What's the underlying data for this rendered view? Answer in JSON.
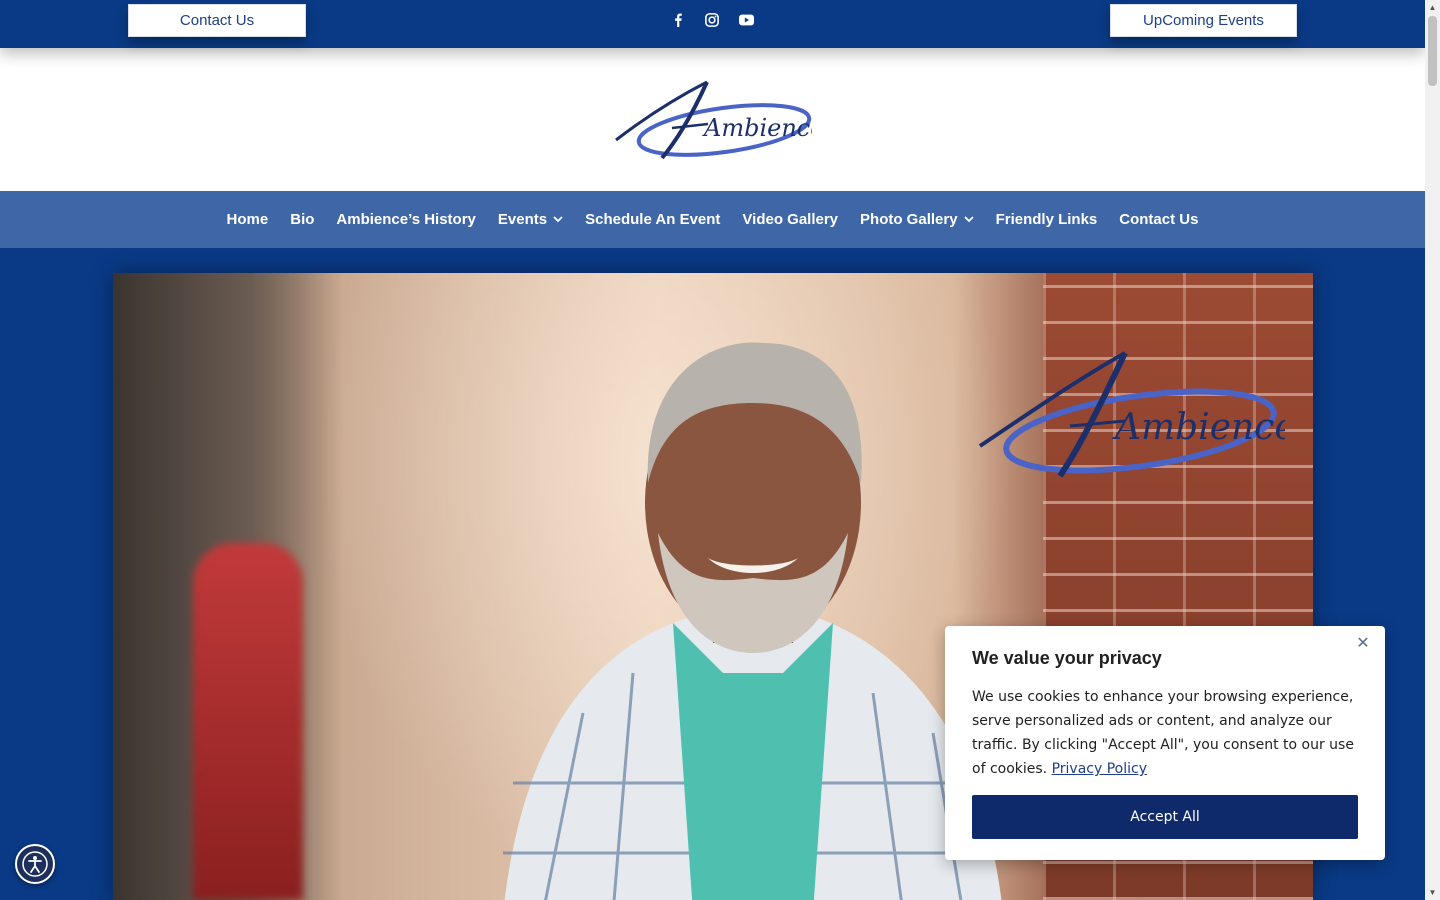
{
  "topbar": {
    "contact_label": "Contact Us",
    "events_label": "UpComing Events",
    "social_icons": [
      "facebook-icon",
      "instagram-icon",
      "youtube-icon"
    ]
  },
  "logo": {
    "text": "Ambience",
    "colors": {
      "primary": "#1d2f6b",
      "swoosh": "#4a63c7"
    }
  },
  "nav": {
    "items": [
      {
        "label": "Home",
        "has_dropdown": false
      },
      {
        "label": "Bio",
        "has_dropdown": false
      },
      {
        "label": "Ambience’s History",
        "has_dropdown": false
      },
      {
        "label": "Events",
        "has_dropdown": true
      },
      {
        "label": "Schedule An Event",
        "has_dropdown": false
      },
      {
        "label": "Video Gallery",
        "has_dropdown": false
      },
      {
        "label": "Photo Gallery",
        "has_dropdown": true
      },
      {
        "label": "Friendly Links",
        "has_dropdown": false
      },
      {
        "label": "Contact Us",
        "has_dropdown": false
      }
    ],
    "dropdown_icon": "chevron-down-icon"
  },
  "cookie": {
    "title": "We value your privacy",
    "body": "We use cookies to enhance your browsing experience, serve personalized ads or content, and analyze our traffic. By clicking \"Accept All\", you consent to our use of cookies.",
    "policy_link": "Privacy Policy",
    "accept_label": "Accept All",
    "close_icon": "close-icon"
  },
  "accessibility": {
    "icon": "accessibility-icon"
  },
  "colors": {
    "brand_blue": "#0a3a86",
    "nav_blue": "#3f67a8",
    "button_navy": "#0f2a6b"
  }
}
